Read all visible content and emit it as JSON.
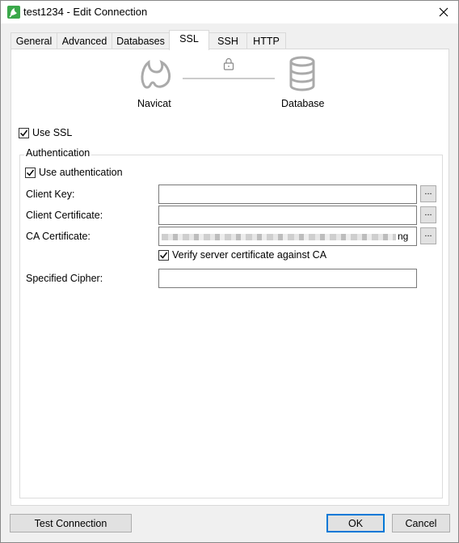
{
  "window": {
    "title": "test1234 - Edit Connection",
    "icon": "navicat-app-icon",
    "close_icon": "close-icon"
  },
  "tabs": [
    {
      "label": "General",
      "active": false
    },
    {
      "label": "Advanced",
      "active": false
    },
    {
      "label": "Databases",
      "active": false
    },
    {
      "label": "SSL",
      "active": true
    },
    {
      "label": "SSH",
      "active": false
    },
    {
      "label": "HTTP",
      "active": false
    }
  ],
  "diagram": {
    "left_label": "Navicat",
    "right_label": "Database",
    "lock_icon": "lock-icon",
    "left_icon": "navicat-logo-icon",
    "right_icon": "database-icon"
  },
  "ssl": {
    "use_ssl_label": "Use SSL",
    "use_ssl_checked": true,
    "auth_group_title": "Authentication",
    "use_auth_label": "Use authentication",
    "use_auth_checked": true,
    "client_key_label": "Client Key:",
    "client_key_value": "",
    "client_cert_label": "Client Certificate:",
    "client_cert_value": "",
    "ca_cert_label": "CA Certificate:",
    "ca_cert_value_suffix": "ng",
    "verify_label": "Verify server certificate against CA",
    "verify_checked": true,
    "cipher_label": "Specified Cipher:",
    "cipher_value": "",
    "browse_label": "..."
  },
  "buttons": {
    "test_connection": "Test Connection",
    "ok": "OK",
    "cancel": "Cancel"
  },
  "colors": {
    "accent": "#0078d7",
    "app_icon": "#3aa84a"
  }
}
